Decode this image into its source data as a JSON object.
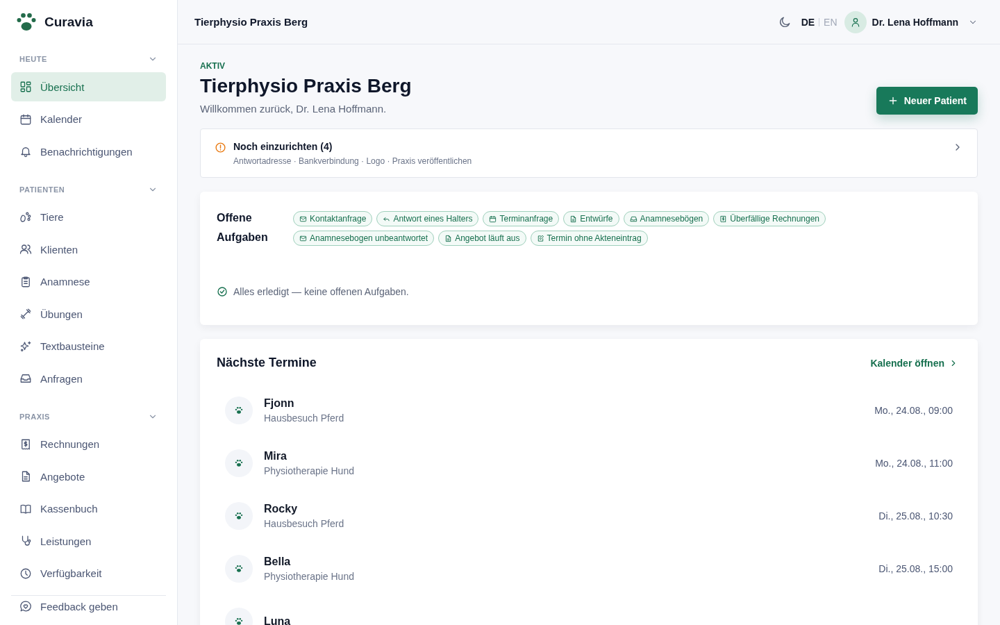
{
  "brand": {
    "name": "Curavia"
  },
  "sidebar": {
    "sections": [
      {
        "label": "HEUTE",
        "expanded": true,
        "items": [
          {
            "label": "Übersicht",
            "selected": true
          },
          {
            "label": "Kalender",
            "selected": false
          },
          {
            "label": "Benachrichtigungen",
            "selected": false
          }
        ]
      },
      {
        "label": "PATIENTEN",
        "expanded": true,
        "items": [
          {
            "label": "Tiere",
            "selected": false
          },
          {
            "label": "Klienten",
            "selected": false
          },
          {
            "label": "Anamnese",
            "selected": false
          },
          {
            "label": "Übungen",
            "selected": false
          },
          {
            "label": "Textbausteine",
            "selected": false
          },
          {
            "label": "Anfragen",
            "selected": false
          }
        ]
      },
      {
        "label": "PRAXIS",
        "expanded": true,
        "items": [
          {
            "label": "Rechnungen",
            "selected": false
          },
          {
            "label": "Angebote",
            "selected": false
          },
          {
            "label": "Kassenbuch",
            "selected": false
          },
          {
            "label": "Leistungen",
            "selected": false
          },
          {
            "label": "Verfügbarkeit",
            "selected": false
          }
        ]
      }
    ],
    "footer_item": {
      "label": "Feedback geben"
    }
  },
  "header": {
    "practice": "Tierphysio Praxis Berg",
    "languages": [
      {
        "label": "DE",
        "selected": true
      },
      {
        "label": "EN",
        "selected": false
      }
    ],
    "user": "Dr. Lena Hoffmann"
  },
  "page": {
    "status": "AKTIV",
    "title": "Tierphysio Praxis Berg",
    "subtitle": "Willkommen zurück, Dr. Lena Hoffmann.",
    "primary_button": "Neuer Patient"
  },
  "setup": {
    "title": "Noch einzurichten (4)",
    "steps": "Antwortadresse · Bankverbindung · Logo · Praxis veröffentlichen"
  },
  "tasks": {
    "title": "Offene Aufgaben",
    "filters": [
      "Kontaktanfrage",
      "Antwort eines Halters",
      "Terminanfrage",
      "Entwürfe",
      "Anamnesebögen",
      "Überfällige Rechnungen",
      "Anamnesebogen unbeantwortet",
      "Angebot läuft aus",
      "Termin ohne Akteneintrag"
    ],
    "empty": "Alles erledigt — keine offenen Aufgaben."
  },
  "appointments": {
    "title": "Nächste Termine",
    "link": "Kalender öffnen",
    "rows": [
      {
        "name": "Fjonn",
        "type": "Hausbesuch Pferd",
        "time": "Mo., 24.08., 09:00"
      },
      {
        "name": "Mira",
        "type": "Physiotherapie Hund",
        "time": "Mo., 24.08., 11:00"
      },
      {
        "name": "Rocky",
        "type": "Hausbesuch Pferd",
        "time": "Di., 25.08., 10:30"
      },
      {
        "name": "Bella",
        "type": "Physiotherapie Hund",
        "time": "Di., 25.08., 15:00"
      },
      {
        "name": "Luna"
      }
    ]
  }
}
